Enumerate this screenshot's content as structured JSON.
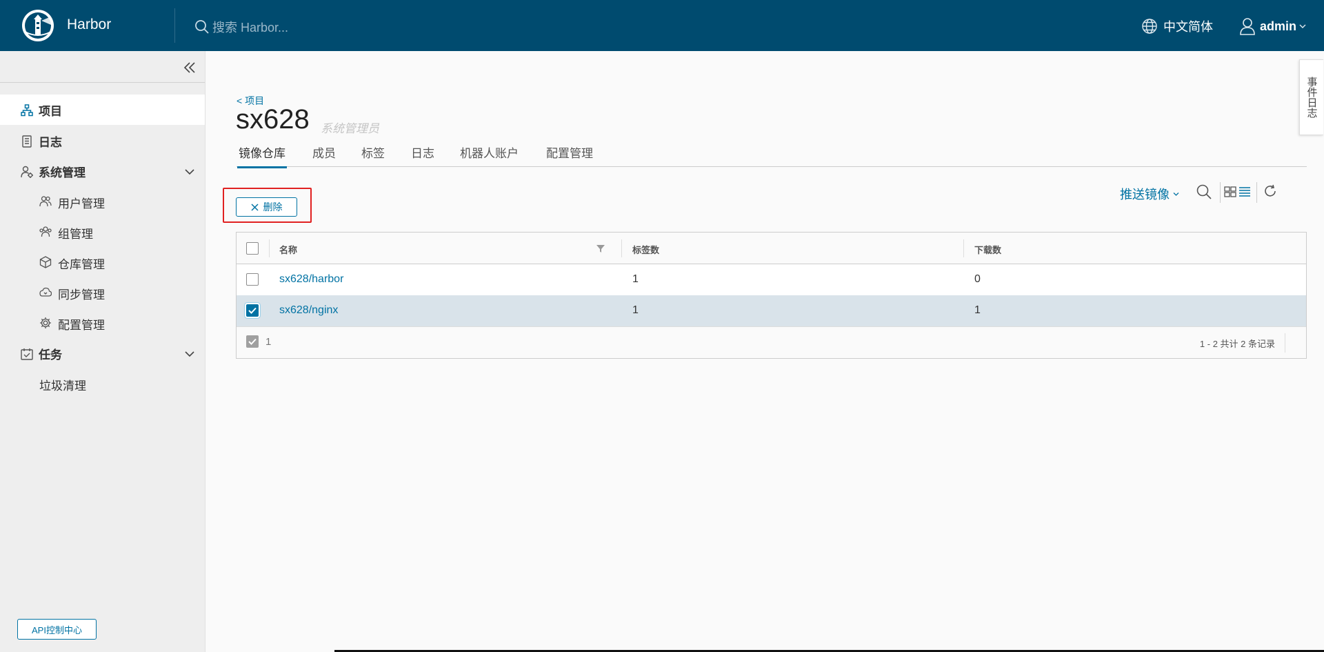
{
  "header": {
    "brand": "Harbor",
    "search_placeholder": "搜索 Harbor...",
    "language": "中文简体",
    "user": "admin"
  },
  "sidebar": {
    "items": [
      {
        "label": "项目",
        "icon": "projects-icon",
        "active": true
      },
      {
        "label": "日志",
        "icon": "logs-icon"
      },
      {
        "label": "系统管理",
        "icon": "admin-icon",
        "expandable": true
      },
      {
        "label": "用户管理",
        "icon": "users-icon",
        "sub": true
      },
      {
        "label": "组管理",
        "icon": "groups-icon",
        "sub": true
      },
      {
        "label": "仓库管理",
        "icon": "registry-icon",
        "sub": true
      },
      {
        "label": "同步管理",
        "icon": "replication-icon",
        "sub": true
      },
      {
        "label": "配置管理",
        "icon": "settings-icon",
        "sub": true
      },
      {
        "label": "任务",
        "icon": "tasks-icon",
        "expandable": true
      },
      {
        "label": "垃圾清理",
        "sub": true
      }
    ],
    "api_button": "API控制中心"
  },
  "project": {
    "breadcrumb": "< 项目",
    "name": "sx628",
    "role": "系统管理员"
  },
  "tabs": [
    "镜像仓库",
    "成员",
    "标签",
    "日志",
    "机器人账户",
    "配置管理"
  ],
  "active_tab": "镜像仓库",
  "side_panel_tab": "事件日志",
  "toolbar": {
    "delete_label": "删除",
    "push_label": "推送镜像"
  },
  "table": {
    "columns": [
      "名称",
      "标签数",
      "下载数"
    ],
    "rows": [
      {
        "name": "sx628/harbor",
        "tags": "1",
        "pulls": "0",
        "selected": false
      },
      {
        "name": "sx628/nginx",
        "tags": "1",
        "pulls": "1",
        "selected": true
      }
    ],
    "selected_count": "1",
    "pagination": "1 - 2 共计 2 条记录"
  },
  "colors": {
    "header_bg": "#004b6f",
    "accent": "#0072a3",
    "highlight_box": "#e02020",
    "selected_row": "#d9e3ea"
  }
}
